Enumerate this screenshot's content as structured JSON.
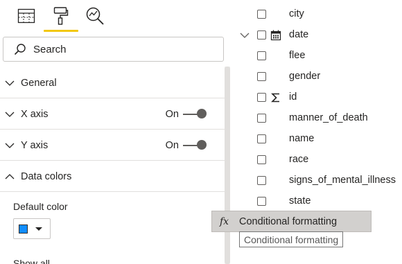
{
  "format_pane": {
    "tabs": [
      {
        "name": "fields-tab",
        "icon": "table-fields-icon"
      },
      {
        "name": "format-tab",
        "icon": "paint-roller-icon",
        "active": true
      },
      {
        "name": "analytics-tab",
        "icon": "analytics-magnifier-icon"
      }
    ],
    "accent_color": "#f2c811",
    "search": {
      "placeholder": "Search",
      "icon": "search-icon"
    },
    "sections": [
      {
        "label": "General",
        "expanded": false
      },
      {
        "label": "X axis",
        "expanded": false,
        "toggle": "On"
      },
      {
        "label": "Y axis",
        "expanded": false,
        "toggle": "On"
      },
      {
        "label": "Data colors",
        "expanded": true
      }
    ],
    "default_color": {
      "label": "Default color",
      "value": "#118dff"
    },
    "show_all_label": "Show all"
  },
  "fields_pane": {
    "fields": [
      {
        "name": "city"
      },
      {
        "name": "date",
        "icon": "calendar-icon",
        "expandable": true
      },
      {
        "name": "flee"
      },
      {
        "name": "gender"
      },
      {
        "name": "id",
        "icon": "sigma-icon"
      },
      {
        "name": "manner_of_death"
      },
      {
        "name": "name"
      },
      {
        "name": "race"
      },
      {
        "name": "signs_of_mental_illness"
      },
      {
        "name": "state"
      }
    ]
  },
  "context_menu": {
    "icon": "fx-icon",
    "icon_text": "fx",
    "label": "Conditional formatting"
  },
  "tooltip": {
    "text": "Conditional formatting"
  }
}
